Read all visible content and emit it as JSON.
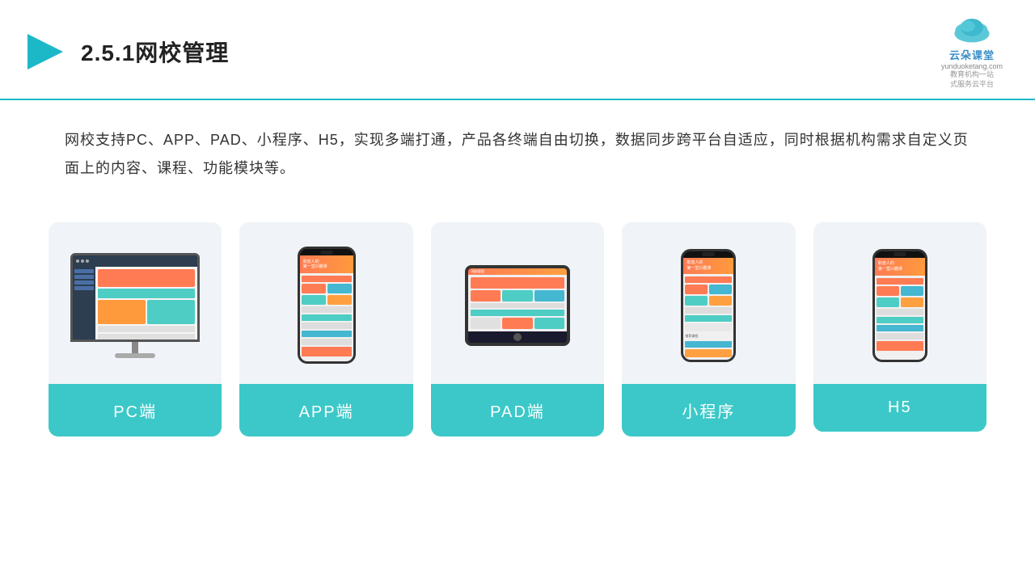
{
  "header": {
    "title": "2.5.1网校管理",
    "logo_name": "云朵课堂",
    "logo_domain": "yunduoketang.com",
    "logo_tagline": "教育机构一站\n式服务云平台"
  },
  "description": {
    "text": "网校支持PC、APP、PAD、小程序、H5，实现多端打通，产品各终端自由切换，数据同步跨平台自适应，同时根据机构需求自定义页面上的内容、课程、功能模块等。"
  },
  "cards": [
    {
      "id": "pc",
      "label": "PC端"
    },
    {
      "id": "app",
      "label": "APP端"
    },
    {
      "id": "pad",
      "label": "PAD端"
    },
    {
      "id": "miniprogram",
      "label": "小程序"
    },
    {
      "id": "h5",
      "label": "H5"
    }
  ],
  "colors": {
    "accent": "#3cc8c8",
    "border_bottom": "#1db8c8",
    "text_primary": "#333",
    "bg_card": "#f0f4f8"
  }
}
